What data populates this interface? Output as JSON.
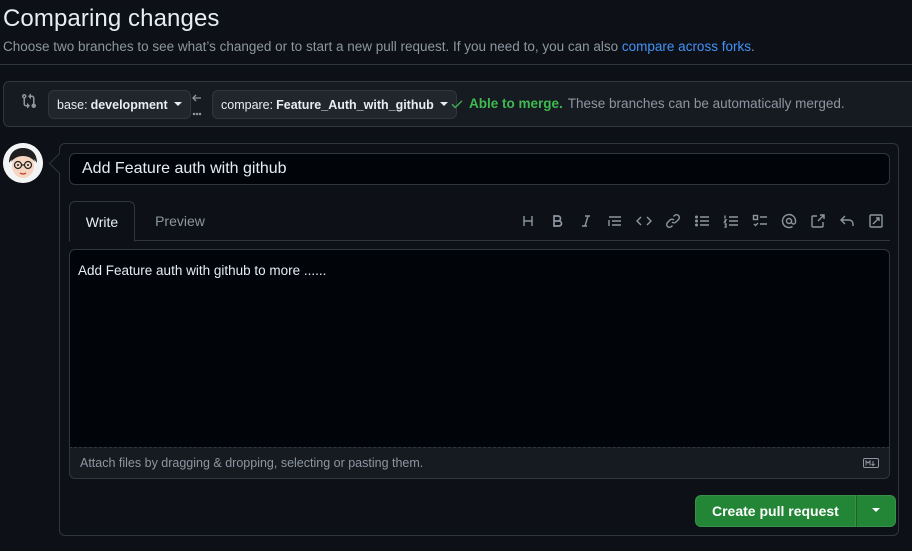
{
  "header": {
    "title": "Comparing changes",
    "subtitle": "Choose two branches to see what’s changed or to start a new pull request. If you need to, you can also",
    "subtitle_link": "compare across forks",
    "subtitle_end": "."
  },
  "range": {
    "base_prefix": "base:",
    "base_value": "development",
    "compare_prefix": "compare:",
    "compare_value": "Feature_Auth_with_github",
    "merge_status": "Able to merge.",
    "merge_message": "These branches can be automatically merged."
  },
  "pr": {
    "title_value": "Add Feature auth with github",
    "tabs": [
      "Write",
      "Preview"
    ],
    "body_value": "Add Feature auth with github to more ......",
    "attach_text": "Attach files by dragging & dropping, selecting or pasting them.",
    "create_button": "Create pull request"
  },
  "toolbar_icons": [
    "heading-icon",
    "bold-icon",
    "italic-icon",
    "quote-icon",
    "code-icon",
    "link-icon",
    "unordered-list-icon",
    "ordered-list-icon",
    "task-list-icon",
    "mention-icon",
    "cross-reference-icon",
    "reply-icon",
    "fullscreen-icon"
  ],
  "colors": {
    "background": "#0d1117",
    "accent_link": "#4493f8",
    "success": "#3fb950",
    "button_green": "#238636"
  }
}
